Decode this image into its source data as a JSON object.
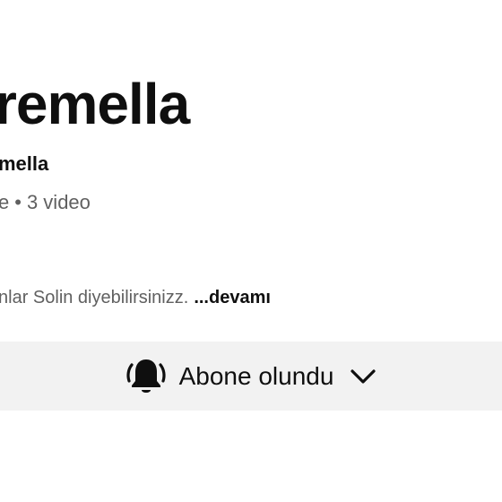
{
  "channel": {
    "name": "remella",
    "handle": "mella",
    "meta_prefix": "e",
    "meta_separator": "•",
    "video_count": "3 video",
    "description": "nlar Solin diyebilirsinizz.",
    "more_label": "...devamı"
  },
  "subscribe": {
    "label": "Abone olundu",
    "bell_icon": "bell-ring-icon",
    "dropdown_icon": "chevron-down-icon"
  }
}
